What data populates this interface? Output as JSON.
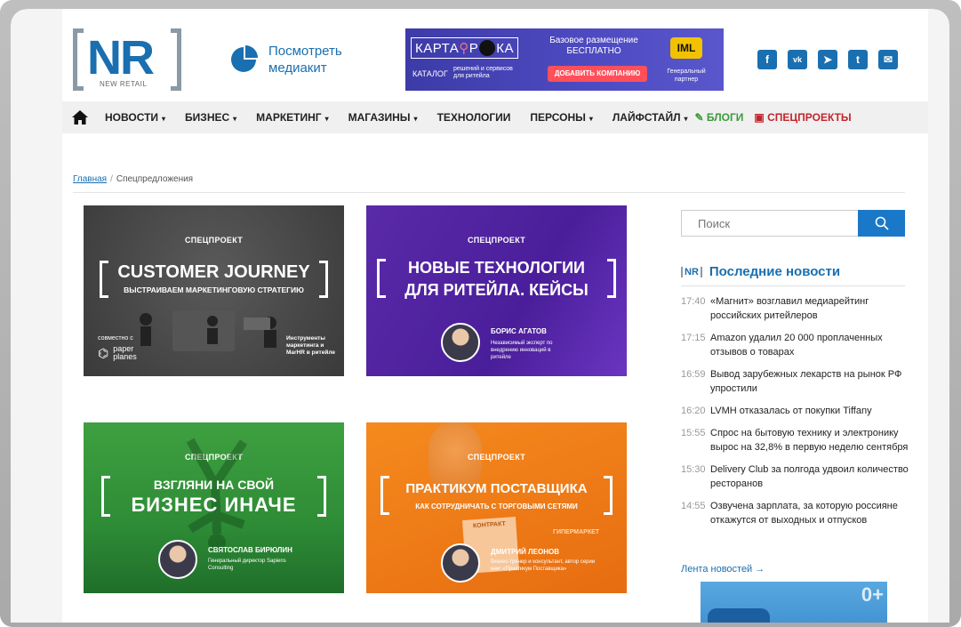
{
  "header": {
    "logo_text": "NR",
    "logo_sub": "NEW RETAIL",
    "mediakit_label": "Посмотреть медиакит",
    "banner": {
      "brand_part1": "КАРТА",
      "brand_part2": "Р",
      "brand_part3": "КА",
      "catalog_label": "КАТАЛОГ",
      "catalog_desc": "решений и сервисов для ритейла",
      "base_text": "Базовое размещение БЕСПЛАТНО",
      "cta_label": "ДОБАВИТЬ КОМПАНИЮ",
      "partner_logo": "IML",
      "partner_label": "Генеральный партнер"
    },
    "socials": [
      {
        "name": "facebook-icon",
        "glyph": "f"
      },
      {
        "name": "vk-icon",
        "glyph": "vk"
      },
      {
        "name": "telegram-icon",
        "glyph": "➤"
      },
      {
        "name": "twitter-icon",
        "glyph": "t"
      },
      {
        "name": "mail-icon",
        "glyph": "✉"
      }
    ],
    "accent_color": "#1a6fb0"
  },
  "nav": {
    "items": [
      {
        "label": "НОВОСТИ",
        "caret": "▾"
      },
      {
        "label": "БИЗНЕС",
        "caret": "▾"
      },
      {
        "label": "МАРКЕТИНГ",
        "caret": "▾"
      },
      {
        "label": "МАГАЗИНЫ",
        "caret": "▾"
      },
      {
        "label": "ТЕХНОЛОГИИ",
        "caret": ""
      },
      {
        "label": "ПЕРСОНЫ",
        "caret": "▾"
      },
      {
        "label": "ЛАЙФСТАЙЛ",
        "caret": "▾"
      }
    ],
    "blogs_label": "✎ БЛОГИ",
    "special_label": "▣ СПЕЦПРОЕКТЫ"
  },
  "breadcrumb": {
    "home": "Главная",
    "separator": "/",
    "current": "Спецпредложения"
  },
  "cards": [
    {
      "tag": "СПЕЦПРОЕКТ",
      "title": "CUSTOMER JOURNEY",
      "subtitle": "ВЫСТРАИВАЕМ МАРКЕТИНГОВУЮ СТРАТЕГИЮ",
      "with_label": "совместно с",
      "partner": "paper planes",
      "note": "Инструменты маркетинга и MarHR в ритейле"
    },
    {
      "tag": "СПЕЦПРОЕКТ",
      "title_line1": "НОВЫЕ ТЕХНОЛОГИИ",
      "title_line2": "ДЛЯ РИТЕЙЛА. КЕЙСЫ",
      "person_name": "БОРИС АГАТОВ",
      "person_desc": "Независимый эксперт по внедрению инноваций в ритейле"
    },
    {
      "tag": "СПЕЦПРОЕКТ",
      "title_line1": "ВЗГЛЯНИ НА СВОЙ",
      "title_line2": "БИЗНЕС ИНАЧЕ",
      "person_name": "СВЯТОСЛАВ БИРЮЛИН",
      "person_desc": "Генеральный директор Sapiens Consulting"
    },
    {
      "tag": "СПЕЦПРОЕКТ",
      "title": "ПРАКТИКУМ ПОСТАВЩИКА",
      "subtitle": "КАК СОТРУДНИЧАТЬ С ТОРГОВЫМИ СЕТЯМИ",
      "contract": "КОНТРАКТ",
      "store": "ГИПЕРМАРКЕТ",
      "person_name": "ДМИТРИЙ ЛЕОНОВ",
      "person_desc": "бизнес-тренер и консультант, автор серии книг «Практикум Поставщика»"
    }
  ],
  "sidebar": {
    "search_placeholder": "Поиск",
    "news_logo": "NR",
    "news_title": "Последние новости",
    "news": [
      {
        "time": "17:40",
        "text": "«Магнит» возглавил медиарейтинг российских ритейлеров"
      },
      {
        "time": "17:15",
        "text": "Amazon удалил 20 000 проплаченных отзывов о товарах"
      },
      {
        "time": "16:59",
        "text": "Вывод зарубежных лекарств на рынок РФ упростили"
      },
      {
        "time": "16:20",
        "text": "LVMH отказалась от покупки Tiffany"
      },
      {
        "time": "15:55",
        "text": "Спрос на бытовую технику и электронику вырос на 32,8% в первую неделю сентября"
      },
      {
        "time": "15:30",
        "text": "Delivery Club за полгода удвоил количество ресторанов"
      },
      {
        "time": "14:55",
        "text": "Озвучена зарплата, за которую россияне откажутся от выходных и отпусков"
      }
    ],
    "feed_link": "Лента новостей →",
    "ad_badge": "0+"
  }
}
